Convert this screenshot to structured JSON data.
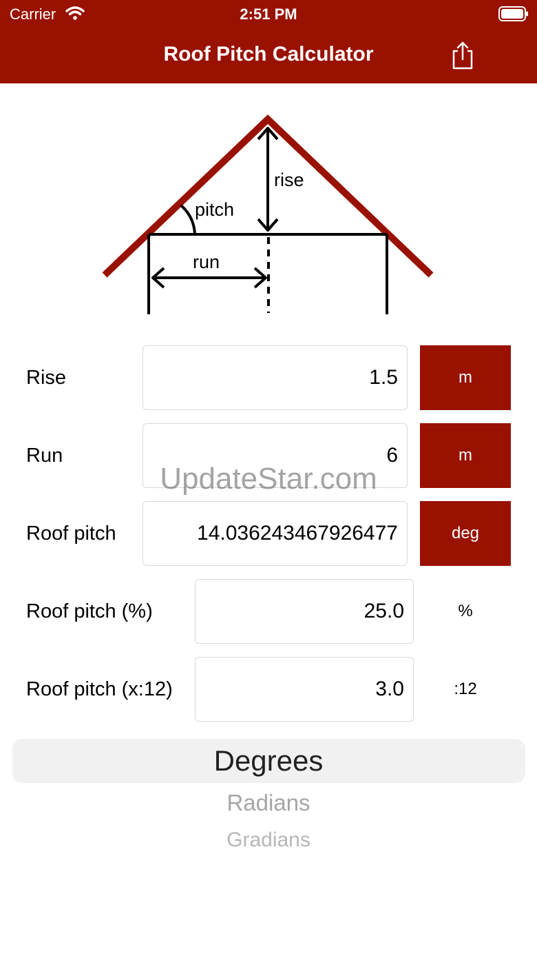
{
  "status_bar": {
    "carrier": "Carrier",
    "time": "2:51 PM"
  },
  "nav": {
    "title": "Roof Pitch Calculator",
    "share_icon": "share-icon"
  },
  "diagram": {
    "labels": {
      "rise": "rise",
      "pitch": "pitch",
      "run": "run"
    },
    "roof_color": "#991100"
  },
  "fields": [
    {
      "label": "Rise",
      "value": "1.5",
      "unit": "m",
      "unit_is_button": true
    },
    {
      "label": "Run",
      "value": "6",
      "unit": "m",
      "unit_is_button": true
    },
    {
      "label": "Roof pitch",
      "value": "14.036243467926477",
      "unit": "deg",
      "unit_is_button": true
    },
    {
      "label": "Roof pitch (%)",
      "value": "25.0",
      "unit": "%",
      "unit_is_button": false
    },
    {
      "label": "Roof pitch (x:12)",
      "value": "3.0",
      "unit": ":12",
      "unit_is_button": false
    }
  ],
  "watermark": "UpdateStar.com",
  "picker": {
    "selected": "Degrees",
    "options": [
      "Radians",
      "Gradians"
    ]
  },
  "colors": {
    "accent": "#991100"
  }
}
